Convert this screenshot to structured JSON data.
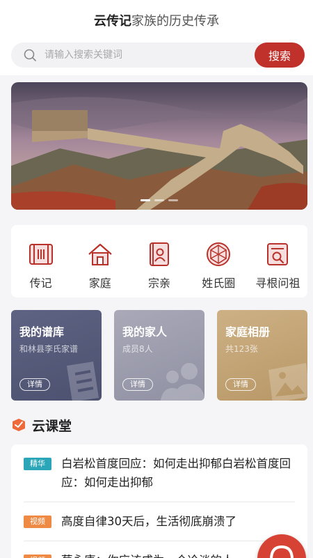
{
  "header": {
    "brand": "云传记",
    "tagline": "家族的历史传承"
  },
  "search": {
    "placeholder": "请输入搜索关键词",
    "button_label": "搜索"
  },
  "banner": {
    "slide_count": 3,
    "active_index": 0
  },
  "categories": [
    {
      "label": "传记",
      "icon": "scroll-icon"
    },
    {
      "label": "家庭",
      "icon": "house-icon"
    },
    {
      "label": "宗亲",
      "icon": "clan-book-icon"
    },
    {
      "label": "姓氏圈",
      "icon": "surname-circle-icon"
    },
    {
      "label": "寻根问祖",
      "icon": "search-roots-icon"
    }
  ],
  "cards": [
    {
      "title": "我的谱库",
      "subtitle": "和林县李氏家谱",
      "button": "详情",
      "icon": "document-icon"
    },
    {
      "title": "我的家人",
      "subtitle": "成员8人",
      "button": "详情",
      "icon": "people-icon"
    },
    {
      "title": "家庭相册",
      "subtitle": "共123张",
      "button": "详情",
      "icon": "photo-icon"
    }
  ],
  "cloud_class": {
    "title": "云课堂",
    "items": [
      {
        "tag": "精华",
        "text": "白岩松首度回应：如何走出抑郁白岩松首度回应：如何走出抑郁"
      },
      {
        "tag": "视频",
        "text": "高度自律30天后，生活彻底崩溃了"
      },
      {
        "tag": "视频",
        "text": "蔡永康：你应该成为一个冷淡的人"
      }
    ]
  },
  "colors": {
    "brand_red": "#c0312b",
    "tag_featured": "#2aa6b8",
    "tag_video": "#ee8a43"
  }
}
